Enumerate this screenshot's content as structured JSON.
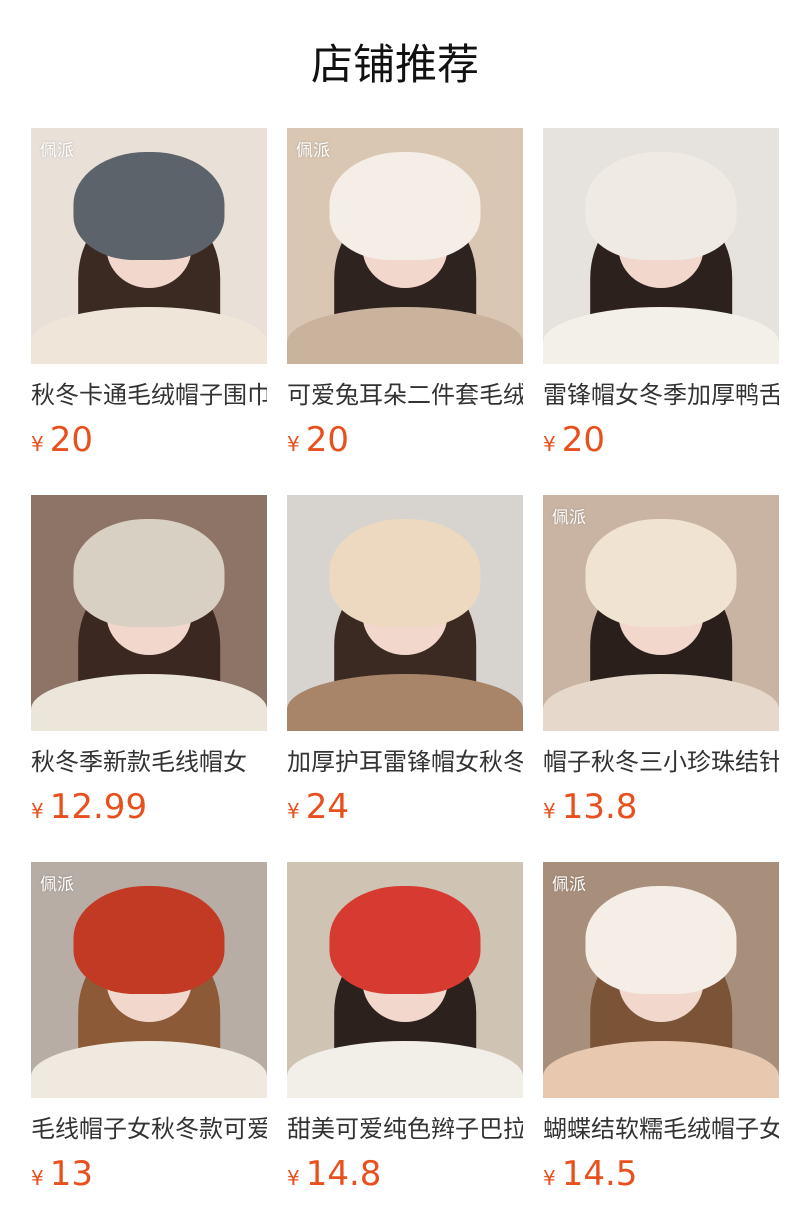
{
  "page_title": "店铺推荐",
  "products": [
    {
      "name": "秋冬卡通毛绒帽子围巾",
      "currency": "¥",
      "price": "20",
      "logo": "佩派",
      "palette": {
        "bg": "#e9e1d8",
        "hat": "#5d636a",
        "hair": "#3b2a22",
        "body": "#efe6d9"
      }
    },
    {
      "name": "可爱兔耳朵二件套毛绒",
      "currency": "¥",
      "price": "20",
      "logo": "佩派",
      "palette": {
        "bg": "#d9c7b3",
        "hat": "#f5eee6",
        "hair": "#2f2320",
        "body": "#c9b39c"
      }
    },
    {
      "name": "雷锋帽女冬季加厚鸭舌",
      "currency": "¥",
      "price": "20",
      "logo": "",
      "palette": {
        "bg": "#e6e3df",
        "hat": "#efeae3",
        "hair": "#2c211d",
        "body": "#f3efe9"
      }
    },
    {
      "name": "秋冬季新款毛线帽女",
      "currency": "¥",
      "price": "12.99",
      "logo": "",
      "palette": {
        "bg": "#8d7466",
        "hat": "#d9d0c4",
        "hair": "#3b2820",
        "body": "#ece5da"
      }
    },
    {
      "name": "加厚护耳雷锋帽女秋冬",
      "currency": "¥",
      "price": "24",
      "logo": "",
      "palette": {
        "bg": "#d7d4d0",
        "hat": "#ecd9c0",
        "hair": "#3a2a22",
        "body": "#a88469"
      }
    },
    {
      "name": "帽子秋冬三小珍珠结针",
      "currency": "¥",
      "price": "13.8",
      "logo": "佩派",
      "palette": {
        "bg": "#c9b4a3",
        "hat": "#f1e3d2",
        "hair": "#2a1f1b",
        "body": "#e6d8cb"
      }
    },
    {
      "name": "毛线帽子女秋冬款可爱",
      "currency": "¥",
      "price": "13",
      "logo": "佩派",
      "palette": {
        "bg": "#b8ada4",
        "hat": "#c23a24",
        "hair": "#8c5a36",
        "body": "#f0e9df"
      }
    },
    {
      "name": "甜美可爱纯色辫子巴拉",
      "currency": "¥",
      "price": "14.8",
      "logo": "",
      "palette": {
        "bg": "#cfc3b4",
        "hat": "#d63a30",
        "hair": "#2d211d",
        "body": "#f2efe9"
      }
    },
    {
      "name": "蝴蝶结软糯毛绒帽子女",
      "currency": "¥",
      "price": "14.5",
      "logo": "佩派",
      "palette": {
        "bg": "#a88f7c",
        "hat": "#f4eee6",
        "hair": "#7b5438",
        "body": "#e8c9b0"
      }
    }
  ]
}
